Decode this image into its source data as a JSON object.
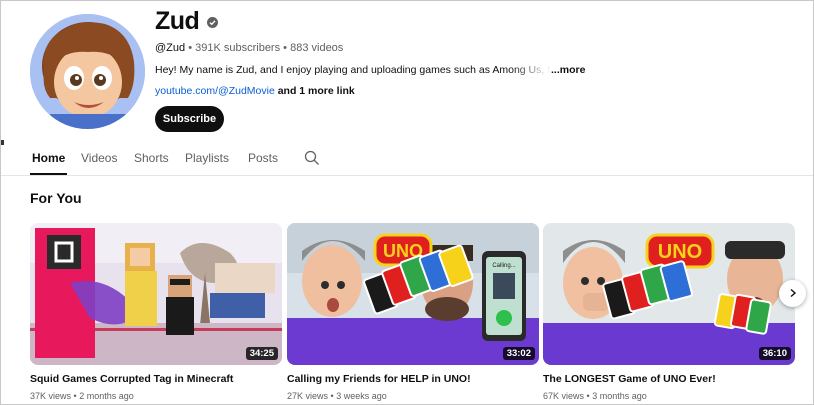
{
  "channel": {
    "name": "Zud",
    "handle": "@Zud",
    "subscribers": "391K subscribers",
    "videos_count": "883 videos",
    "separator": "•",
    "description": "Hey! My name is Zud, and I enjoy playing and uploading games such as Among Us, Minecraft",
    "more_label": "...more",
    "link": "youtube.com/@ZudMovie",
    "extra_links": "and 1 more link",
    "subscribe_label": "Subscribe"
  },
  "tabs": [
    {
      "label": "Home",
      "active": true
    },
    {
      "label": "Videos"
    },
    {
      "label": "Shorts"
    },
    {
      "label": "Playlists"
    },
    {
      "label": "Posts"
    }
  ],
  "section": {
    "title": "For You"
  },
  "videos": [
    {
      "title": "Squid Games Corrupted Tag in Minecraft",
      "views": "37K views",
      "age": "2 months ago",
      "duration": "34:25"
    },
    {
      "title": "Calling my Friends for HELP in UNO!",
      "views": "27K views",
      "age": "3 weeks ago",
      "duration": "33:02"
    },
    {
      "title": "The LONGEST Game of UNO Ever!",
      "views": "67K views",
      "age": "3 months ago",
      "duration": "36:10"
    }
  ],
  "thumbnail_text": {
    "uno": "UNO",
    "calling": "Calling..."
  },
  "colors": {
    "accent_link": "#065fd4",
    "subscribe_bg": "#0f0f0f",
    "uno_red": "#e0201f",
    "uno_yellow": "#f7d21b"
  },
  "icons": [
    "verified-icon",
    "search-icon",
    "chevron-right-icon"
  ]
}
